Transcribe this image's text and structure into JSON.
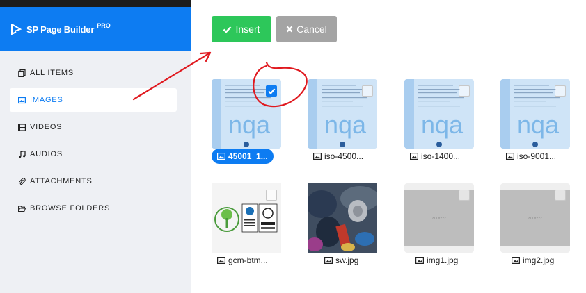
{
  "brand": {
    "name": "SP Page Builder",
    "badge": "PRO"
  },
  "nav": [
    {
      "label": "ALL ITEMS",
      "icon": "copy-icon"
    },
    {
      "label": "IMAGES",
      "icon": "image-icon",
      "active": true
    },
    {
      "label": "VIDEOS",
      "icon": "film-icon"
    },
    {
      "label": "AUDIOS",
      "icon": "music-icon"
    },
    {
      "label": "ATTACHMENTS",
      "icon": "paperclip-icon"
    },
    {
      "label": "BROWSE FOLDERS",
      "icon": "folder-open-icon"
    }
  ],
  "toolbar": {
    "insert_label": "Insert",
    "cancel_label": "Cancel"
  },
  "media": [
    {
      "name": "45001_1...",
      "selected": true,
      "kind": "certificate"
    },
    {
      "name": "iso-4500...",
      "selected": false,
      "kind": "certificate"
    },
    {
      "name": "iso-1400...",
      "selected": false,
      "kind": "certificate"
    },
    {
      "name": "iso-9001...",
      "selected": false,
      "kind": "certificate"
    },
    {
      "name": "gcm-btm...",
      "selected": false,
      "kind": "logos"
    },
    {
      "name": "sw.jpg",
      "selected": false,
      "kind": "photo"
    },
    {
      "name": "img1.jpg",
      "selected": false,
      "kind": "placeholder"
    },
    {
      "name": "img2.jpg",
      "selected": false,
      "kind": "placeholder"
    }
  ],
  "certificate_text": {
    "heading": "Certificate of Registration",
    "watermark": "nqa"
  },
  "placeholder_text": "800x???",
  "colors": {
    "brand": "#0d7cf2",
    "insert": "#2dc75a",
    "cancel": "#a4a4a4",
    "sidebar": "#eef0f4",
    "annotation": "#e0191f"
  }
}
